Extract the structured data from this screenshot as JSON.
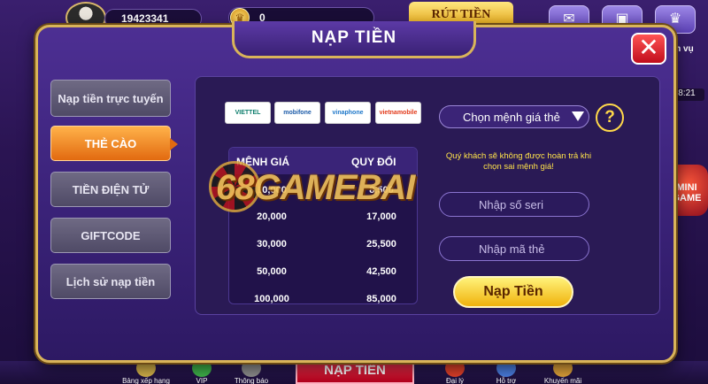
{
  "topbar": {
    "user_id": "19423341",
    "coin_balance": "0",
    "withdraw_label": "RÚT TIỀN"
  },
  "right_side": {
    "mission_label": "iệm vụ",
    "timer": "8:21",
    "mini_game_label": "MINI GAME"
  },
  "modal": {
    "title": "NẠP TIỀN",
    "close_label": "✕"
  },
  "menu": {
    "items": [
      {
        "label": "Nạp tiền trực tuyến",
        "active": false
      },
      {
        "label": "THẺ CÀO",
        "active": true
      },
      {
        "label": "TIỀN ĐIỆN TỬ",
        "active": false
      },
      {
        "label": "GIFTCODE",
        "active": false
      },
      {
        "label": "Lịch sử nạp tiền",
        "active": false
      }
    ]
  },
  "carriers": [
    {
      "label": "VIETTEL",
      "color": "#0c7d6c"
    },
    {
      "label": "mobifone",
      "color": "#1b5aa8"
    },
    {
      "label": "vinaphone",
      "color": "#1e77c9"
    },
    {
      "label": "vietnamobile",
      "color": "#e23a1a"
    }
  ],
  "rate_table": {
    "col_face_value": "MỆNH GIÁ",
    "col_converted": "QUY ĐỔI",
    "rows": [
      {
        "face": "10,000",
        "converted": "8,500"
      },
      {
        "face": "20,000",
        "converted": "17,000"
      },
      {
        "face": "30,000",
        "converted": "25,500"
      },
      {
        "face": "50,000",
        "converted": "42,500"
      },
      {
        "face": "100,000",
        "converted": "85,000"
      }
    ]
  },
  "watermark": "68GAMEBAI",
  "form": {
    "select_placeholder": "Chọn mệnh giá thẻ",
    "help_label": "?",
    "warning": "Quý khách sẽ không được hoàn trả khi chọn sai mệnh giá!",
    "serial_placeholder": "Nhập số seri",
    "code_placeholder": "Nhập mã thẻ",
    "submit_label": "Nạp Tiền"
  },
  "bottom_nav": {
    "items": [
      "Bảng xếp hạng",
      "VIP",
      "Thông báo",
      "Đại lý",
      "Hỗ trợ",
      "Khuyến mãi"
    ],
    "center_tab": "NẠP TIỀN"
  }
}
